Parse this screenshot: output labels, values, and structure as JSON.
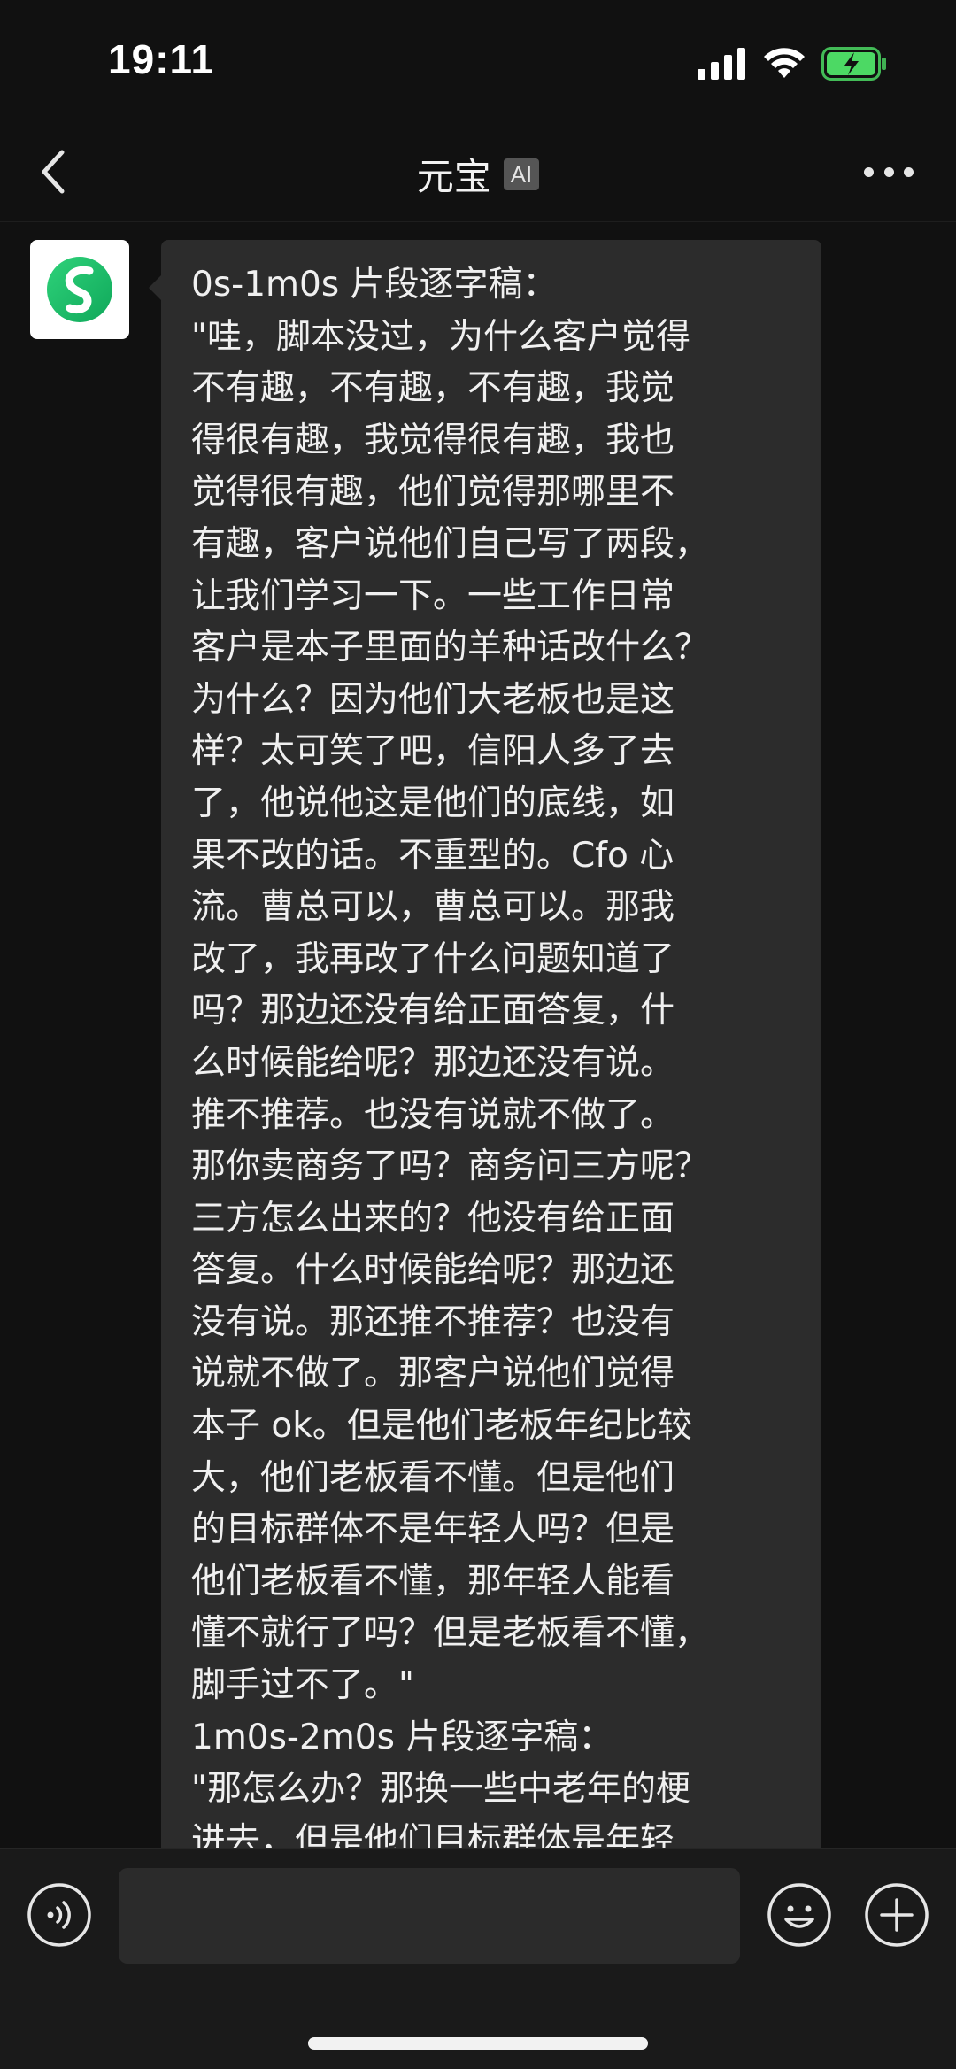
{
  "status_bar": {
    "time": "19:11",
    "icons": [
      "signal-icon",
      "wifi-icon",
      "battery-charging-icon"
    ]
  },
  "nav": {
    "title": "元宝",
    "badge": "AI",
    "back_icon": "back-chevron-icon",
    "more_icon": "more-dots-icon"
  },
  "message": {
    "avatar_icon": "yuanbao-logo-icon",
    "lines": [
      "0s-1m0s 片段逐字稿：",
      "\"哇，脚本没过，为什么客户觉得",
      "不有趣，不有趣，不有趣，我觉",
      "得很有趣，我觉得很有趣，我也",
      "觉得很有趣，他们觉得那哪里不",
      "有趣，客户说他们自己写了两段，",
      "让我们学习一下。一些工作日常",
      "客户是本子里面的羊种话改什么？",
      "为什么？因为他们大老板也是这",
      "样？太可笑了吧，信阳人多了去",
      "了，他说他这是他们的底线，如",
      "果不改的话。不重型的。Cfo 心",
      "流。曹总可以，曹总可以。那我",
      "改了，我再改了什么问题知道了",
      "吗？那边还没有给正面答复，什",
      "么时候能给呢？那边还没有说。",
      "推不推荐。也没有说就不做了。",
      "那你卖商务了吗？商务问三方呢？",
      "三方怎么出来的？他没有给正面",
      "答复。什么时候能给呢？那边还",
      "没有说。那还推不推荐？也没有",
      "说就不做了。那客户说他们觉得",
      "本子 ok。但是他们老板年纪比较",
      "大，他们老板看不懂。但是他们",
      "的目标群体不是年轻人吗？但是",
      "他们老板看不懂，那年轻人能看",
      "懂不就行了吗？但是老板看不懂，",
      "脚手过不了。\"",
      "1m0s-2m0s 片段逐字稿：",
      "\"那怎么办？那换一些中老年的梗",
      "进去，但是他们目标群体是年轻"
    ]
  },
  "input_bar": {
    "placeholder": "",
    "voice_icon": "voice-input-icon",
    "emoji_icon": "emoji-icon",
    "plus_icon": "plus-icon"
  },
  "colors": {
    "background": "#111111",
    "bubble": "#2c2c2c",
    "accent_green": "#1fc16b",
    "battery_green": "#4cd964"
  }
}
